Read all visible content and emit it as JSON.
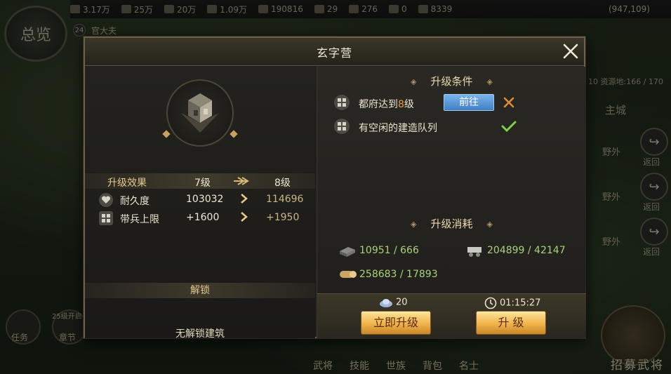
{
  "topbar": {
    "resources": [
      "3.17万",
      "25万",
      "20万",
      "1.09万",
      "190816",
      "29",
      "276",
      "0",
      "8339"
    ],
    "coords": "(947,109)"
  },
  "hud": {
    "logo": "总览",
    "level": "24",
    "rank_title": "官大夫",
    "resource_land": "10 资源地:166 / 170",
    "main_city": "主城",
    "field_labels": [
      "野外",
      "野外",
      "野外"
    ],
    "return_labels": [
      "返回",
      "返回",
      "返回"
    ],
    "left_labels": [
      "任务",
      "章节"
    ],
    "chapter_tag": "25级开启",
    "bottom_nav": [
      "武将",
      "技能",
      "世族",
      "背包",
      "名士"
    ],
    "recruit": "招募武将"
  },
  "modal": {
    "title": "玄字营",
    "effect": {
      "header": "升级效果",
      "from_level": "7级",
      "to_level": "8级",
      "rows": [
        {
          "icon": "heart-icon",
          "name": "耐久度",
          "old": "103032",
          "new": "114696"
        },
        {
          "icon": "grid-icon",
          "name": "带兵上限",
          "old": "+1600",
          "new": "+1950"
        }
      ]
    },
    "unlock": {
      "header": "解锁",
      "text": "无解锁建筑"
    },
    "conditions": {
      "title": "升级条件",
      "items": [
        {
          "pre": "都府达到",
          "hl": "8",
          "post": "级",
          "status": "fail"
        },
        {
          "pre": "有空闲的建造队列",
          "hl": "",
          "post": "",
          "status": "ok"
        }
      ],
      "goto_label": "前往"
    },
    "cost": {
      "title": "升级消耗",
      "items": [
        {
          "icon": "iron-icon",
          "value": "10951 / 666"
        },
        {
          "icon": "stone-cart-icon",
          "value": "204899 / 42147"
        },
        {
          "icon": "wood-icon",
          "value": "258683 / 17893"
        }
      ]
    },
    "footer": {
      "gold_cost": "20",
      "time": "01:15:27",
      "instant_label": "立即升级",
      "upgrade_label": "升 级"
    }
  },
  "colors": {
    "accent_gold": "#e3c98e",
    "cost_green": "#a9d37a",
    "highlight_orange": "#e89b42",
    "button_blue": "#3f7fc4"
  }
}
